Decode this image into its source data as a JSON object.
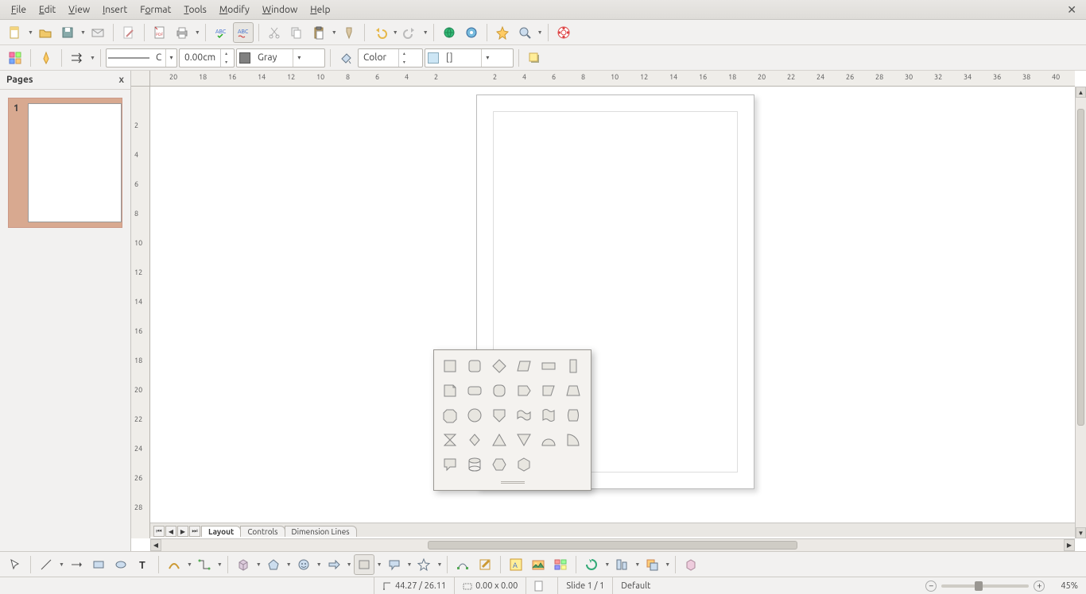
{
  "menu": {
    "items": [
      {
        "pre": "",
        "u": "F",
        "post": "ile"
      },
      {
        "pre": "",
        "u": "E",
        "post": "dit"
      },
      {
        "pre": "",
        "u": "V",
        "post": "iew"
      },
      {
        "pre": "",
        "u": "I",
        "post": "nsert"
      },
      {
        "pre": "F",
        "u": "o",
        "post": "rmat"
      },
      {
        "pre": "",
        "u": "T",
        "post": "ools"
      },
      {
        "pre": "",
        "u": "M",
        "post": "odify"
      },
      {
        "pre": "",
        "u": "W",
        "post": "indow"
      },
      {
        "pre": "",
        "u": "H",
        "post": "elp"
      }
    ],
    "close": "✕"
  },
  "toolbar2": {
    "linestyle": "C",
    "linewidth": "0.00cm",
    "linecolor_label": "Gray",
    "area_style": "Color",
    "area_none": "[]"
  },
  "pages_panel": {
    "title": "Pages",
    "close": "x",
    "page_number": "1"
  },
  "hruler_ticks": [
    "20",
    "18",
    "16",
    "14",
    "12",
    "10",
    "8",
    "6",
    "4",
    "2",
    "",
    "2",
    "4",
    "6",
    "8",
    "10",
    "12",
    "14",
    "16",
    "18",
    "20",
    "22",
    "24",
    "26",
    "28",
    "30",
    "32",
    "34",
    "36",
    "38",
    "40"
  ],
  "vruler_ticks": [
    "",
    "2",
    "4",
    "6",
    "8",
    "10",
    "12",
    "14",
    "16",
    "18",
    "20",
    "22",
    "24",
    "26",
    "28"
  ],
  "tabs": {
    "layout": "Layout",
    "controls": "Controls",
    "dimension": "Dimension Lines"
  },
  "shapes_popup": {
    "shapes": [
      "square",
      "rounded-square",
      "diamond",
      "parallelogram",
      "horizontal-rect",
      "vertical-rect",
      "folded-corner",
      "rounded-rect",
      "rounded-square2",
      "pentagon",
      "right-trapezoid",
      "trapezoid",
      "octagon",
      "circle",
      "shield",
      "wave-rect",
      "flag",
      "cylinder-side",
      "hourglass",
      "diamond-small",
      "triangle-up",
      "triangle-down",
      "half-circle",
      "quarter-circle",
      "speech-bubble",
      "cylinder",
      "hexagon",
      "hexagon2"
    ]
  },
  "status": {
    "coords": "44.27 / 26.11",
    "size": "0.00 x 0.00",
    "slide": "Slide 1 / 1",
    "style": "Default",
    "zoom": "45%"
  }
}
